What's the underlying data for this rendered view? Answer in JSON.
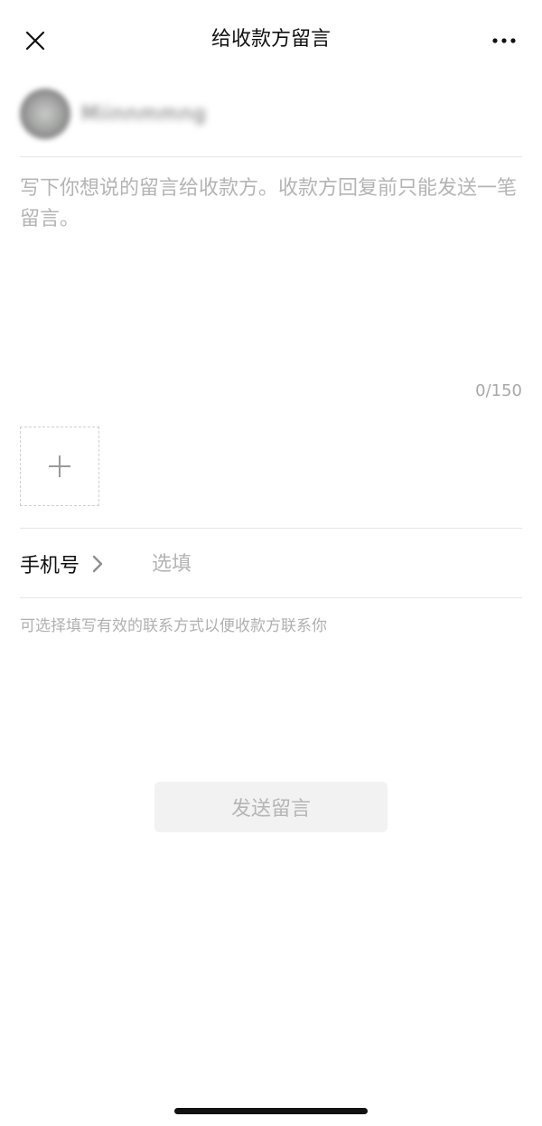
{
  "nav": {
    "title": "给收款方留言",
    "close_icon": "close-icon",
    "more_icon": "more-icon"
  },
  "payee": {
    "name": "Miinnmmng"
  },
  "message": {
    "placeholder": "写下你想说的留言给收款方。收款方回复前只能发送一笔留言。",
    "value": "",
    "counter": "0/150"
  },
  "image_picker": {
    "icon": "plus-icon"
  },
  "phone": {
    "label": "手机号",
    "placeholder": "选填",
    "value": ""
  },
  "hint": "可选择填写有效的联系方式以便收款方联系你",
  "send_button": {
    "label": "发送留言"
  },
  "colors": {
    "background": "#ffffff",
    "text": "#111111",
    "placeholder": "#b4b4b4",
    "divider": "#e6e6e6",
    "button_bg": "#f2f2f2",
    "button_text": "#b5b5b5"
  }
}
